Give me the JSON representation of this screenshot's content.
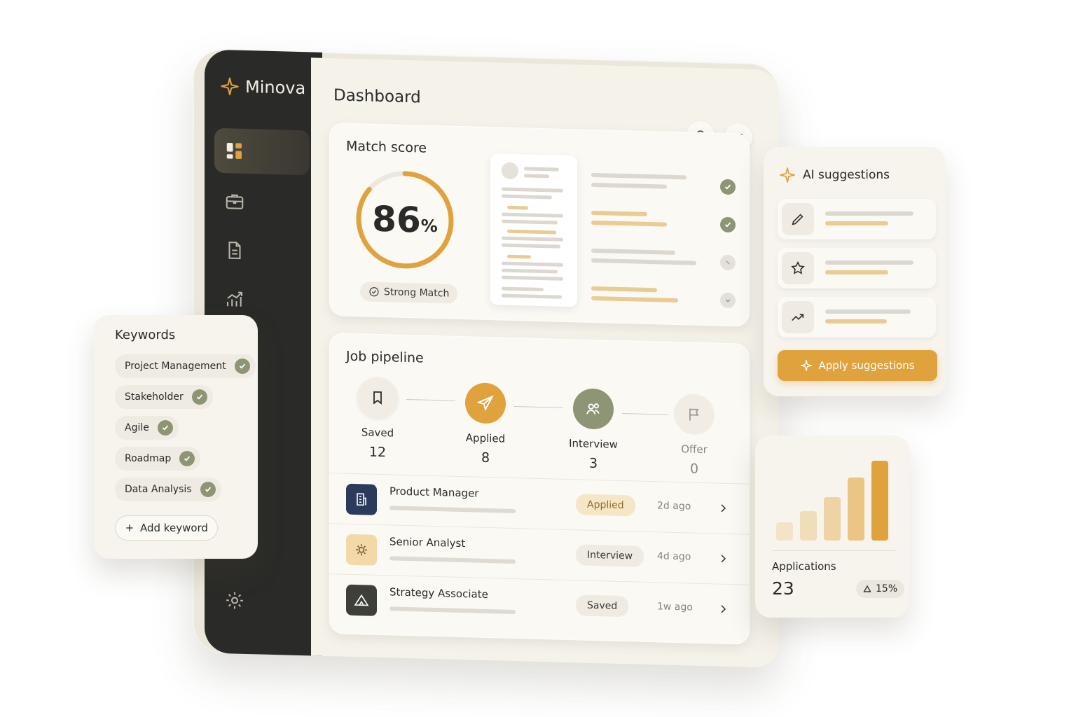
{
  "brand": {
    "name": "Minova"
  },
  "header": {
    "title": "Dashboard"
  },
  "match": {
    "title": "Match score",
    "score": "86",
    "score_fraction": 0.86,
    "unit": "%",
    "badge": "Strong Match"
  },
  "pipeline": {
    "title": "Job pipeline",
    "stages": [
      {
        "label": "Saved",
        "count": "12"
      },
      {
        "label": "Applied",
        "count": "8"
      },
      {
        "label": "Interview",
        "count": "3"
      },
      {
        "label": "Offer",
        "count": "0"
      }
    ],
    "jobs": [
      {
        "title": "Product Manager",
        "status": "Applied",
        "ago": "2d ago"
      },
      {
        "title": "Senior Analyst",
        "status": "Interview",
        "ago": "4d ago"
      },
      {
        "title": "Strategy Associate",
        "status": "Saved",
        "ago": "1w ago"
      }
    ]
  },
  "keywords": {
    "title": "Keywords",
    "items": [
      "Project Management",
      "Stakeholder",
      "Agile",
      "Roadmap",
      "Data Analysis"
    ],
    "add_label": "Add keyword"
  },
  "ai": {
    "title": "AI suggestions",
    "apply_label": "Apply suggestions"
  },
  "applications": {
    "label": "Applications",
    "value": "23",
    "delta": "15%"
  },
  "colors": {
    "accent": "#e0a23c",
    "sidebar": "#2a2a28",
    "success": "#8e9574",
    "navy": "#2c3a5c"
  }
}
